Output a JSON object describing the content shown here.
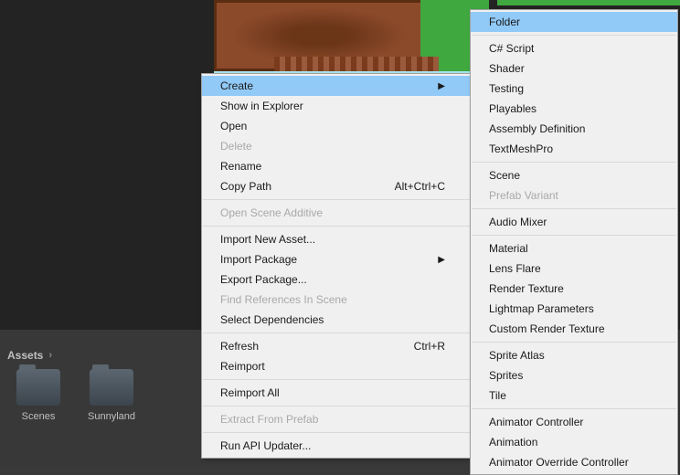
{
  "assets": {
    "header": "Assets",
    "folders": [
      {
        "label": "Scenes"
      },
      {
        "label": "Sunnyland"
      }
    ]
  },
  "menu1": {
    "items": [
      {
        "label": "Create",
        "arrow": true,
        "highlight": true
      },
      {
        "label": "Show in Explorer"
      },
      {
        "label": "Open"
      },
      {
        "label": "Delete",
        "disabled": true
      },
      {
        "label": "Rename"
      },
      {
        "label": "Copy Path",
        "shortcut": "Alt+Ctrl+C"
      },
      {
        "sep": true
      },
      {
        "label": "Open Scene Additive",
        "disabled": true
      },
      {
        "sep": true
      },
      {
        "label": "Import New Asset..."
      },
      {
        "label": "Import Package",
        "arrow": true
      },
      {
        "label": "Export Package..."
      },
      {
        "label": "Find References In Scene",
        "disabled": true
      },
      {
        "label": "Select Dependencies"
      },
      {
        "sep": true
      },
      {
        "label": "Refresh",
        "shortcut": "Ctrl+R"
      },
      {
        "label": "Reimport"
      },
      {
        "sep": true
      },
      {
        "label": "Reimport All"
      },
      {
        "sep": true
      },
      {
        "label": "Extract From Prefab",
        "disabled": true
      },
      {
        "sep": true
      },
      {
        "label": "Run API Updater..."
      }
    ]
  },
  "menu2": {
    "items": [
      {
        "label": "Folder",
        "highlight": true
      },
      {
        "sep": true
      },
      {
        "label": "C# Script"
      },
      {
        "label": "Shader"
      },
      {
        "label": "Testing"
      },
      {
        "label": "Playables"
      },
      {
        "label": "Assembly Definition"
      },
      {
        "label": "TextMeshPro"
      },
      {
        "sep": true
      },
      {
        "label": "Scene"
      },
      {
        "label": "Prefab Variant",
        "disabled": true
      },
      {
        "sep": true
      },
      {
        "label": "Audio Mixer"
      },
      {
        "sep": true
      },
      {
        "label": "Material"
      },
      {
        "label": "Lens Flare"
      },
      {
        "label": "Render Texture"
      },
      {
        "label": "Lightmap Parameters"
      },
      {
        "label": "Custom Render Texture"
      },
      {
        "sep": true
      },
      {
        "label": "Sprite Atlas"
      },
      {
        "label": "Sprites"
      },
      {
        "label": "Tile"
      },
      {
        "sep": true
      },
      {
        "label": "Animator Controller"
      },
      {
        "label": "Animation"
      },
      {
        "label": "Animator Override Controller"
      }
    ]
  }
}
